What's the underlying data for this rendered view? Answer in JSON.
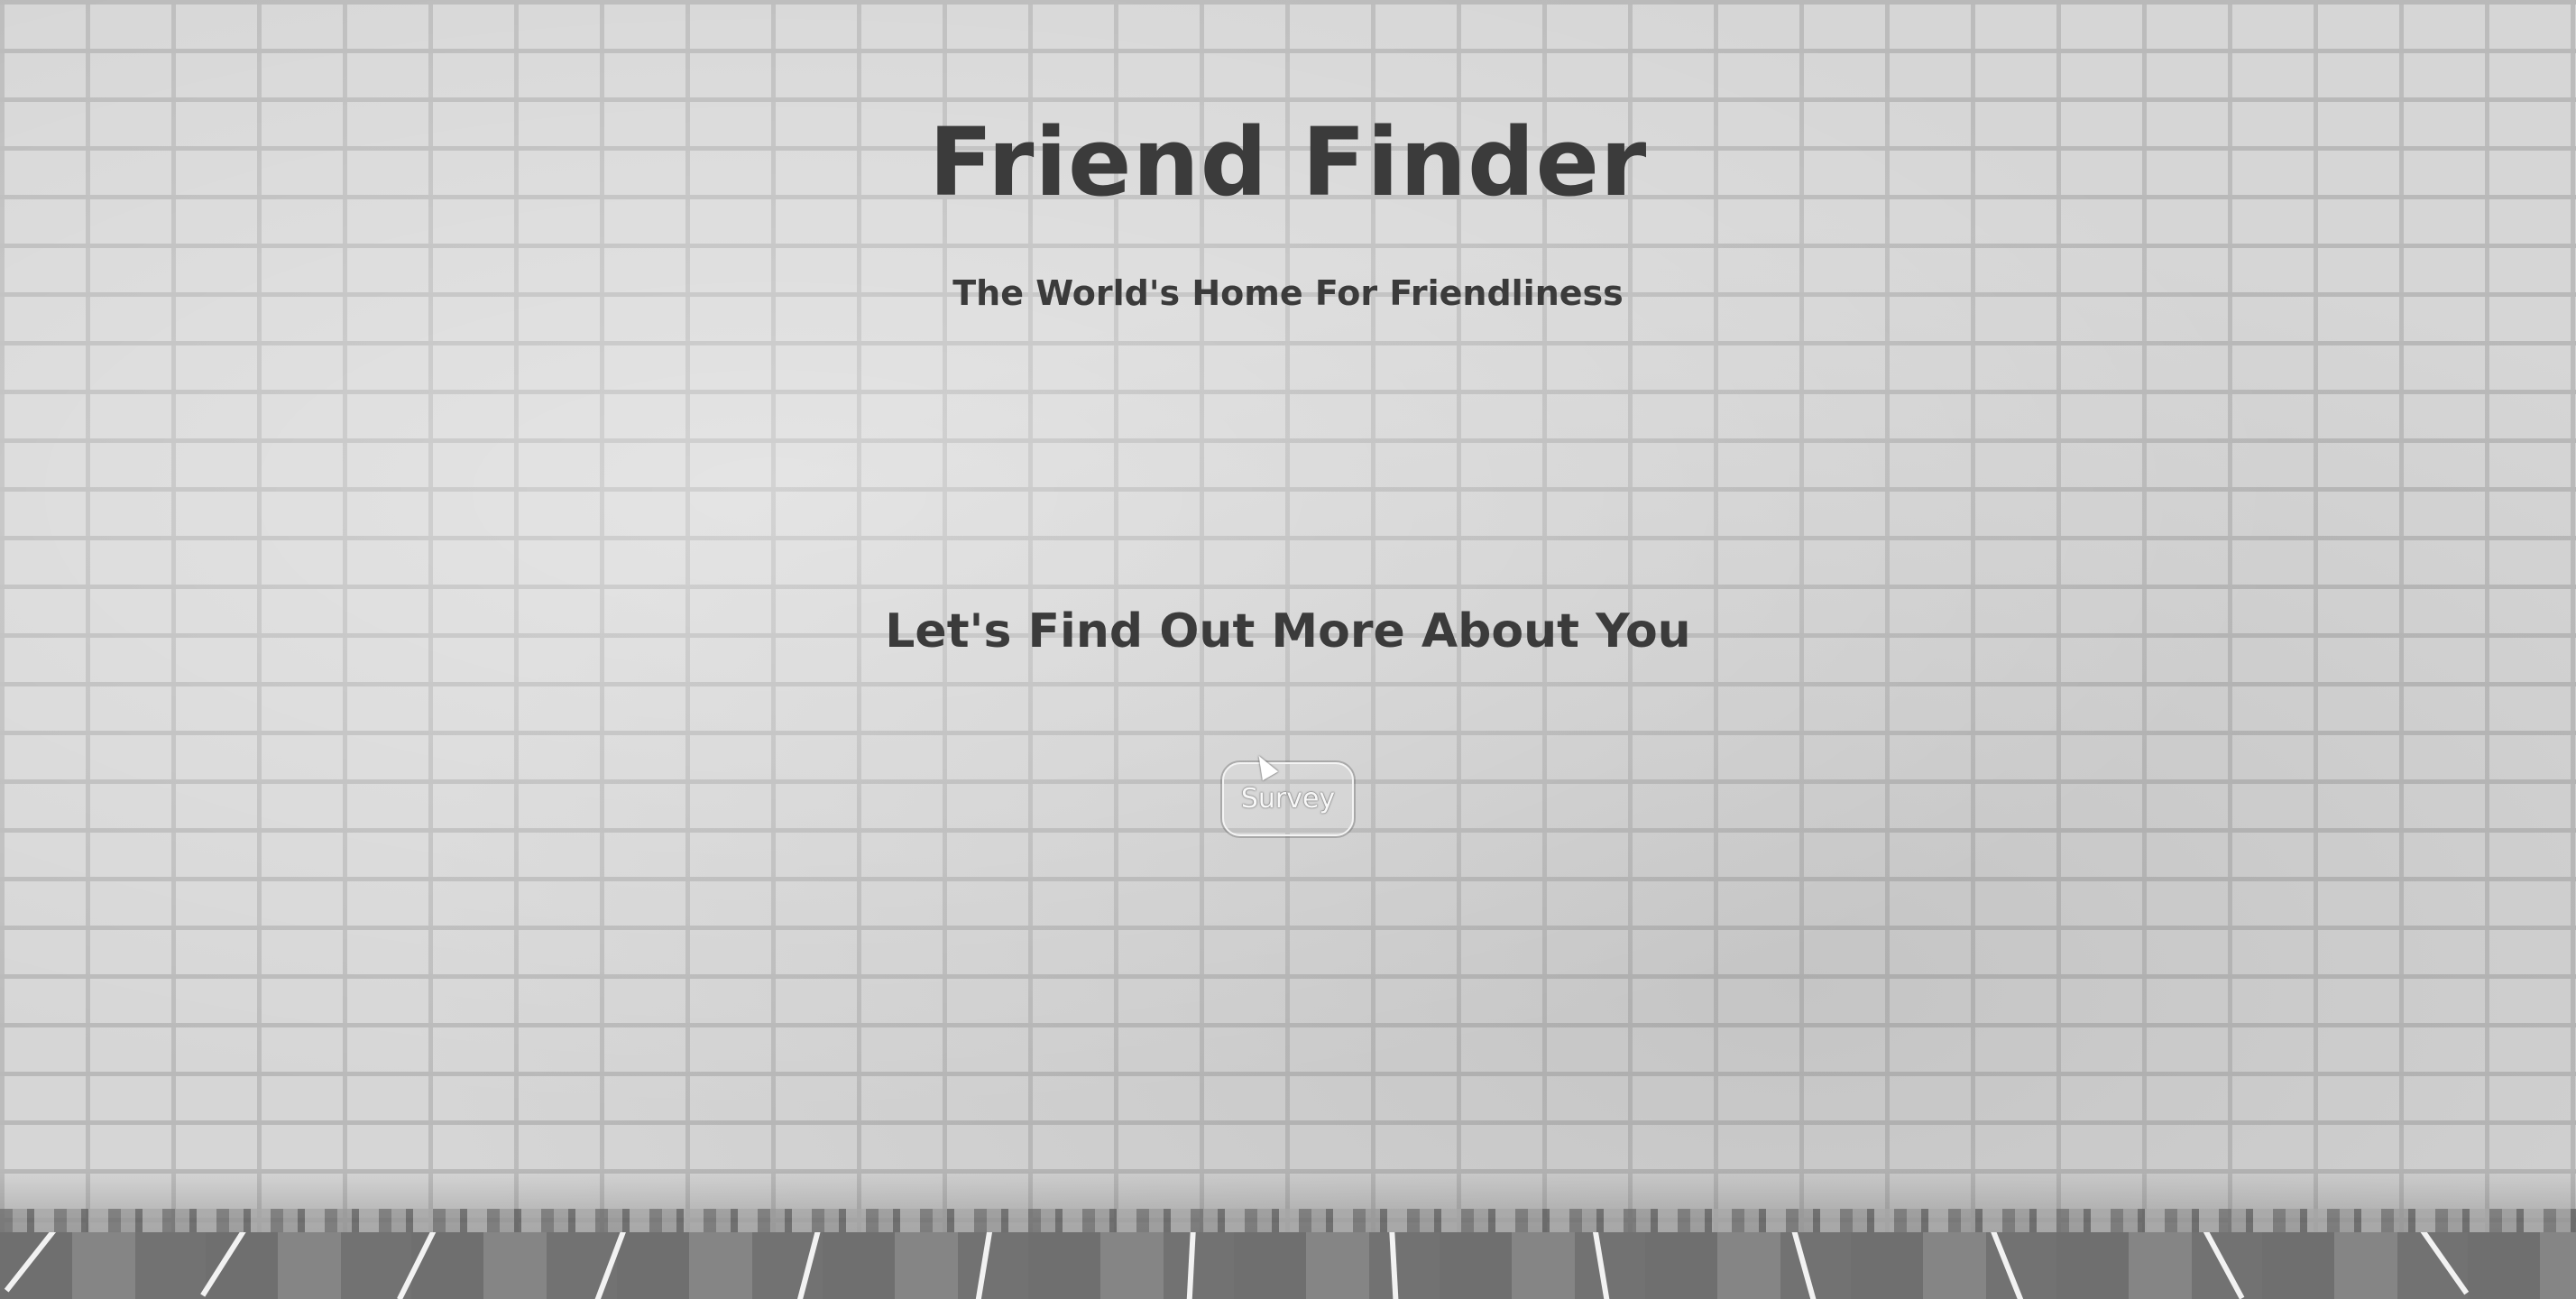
{
  "header": {
    "title": "Friend Finder",
    "subtitle": "The World's Home For Friendliness"
  },
  "main": {
    "heading": "Let's Find Out More About You",
    "survey_button_label": "Survey"
  },
  "icons": {
    "cursor": "mouse-pointer-icon"
  },
  "colors": {
    "text": "#3b3b3b",
    "button_text": "#f8f8f8",
    "wall": "#d6d6d6",
    "floor": "#777777"
  }
}
